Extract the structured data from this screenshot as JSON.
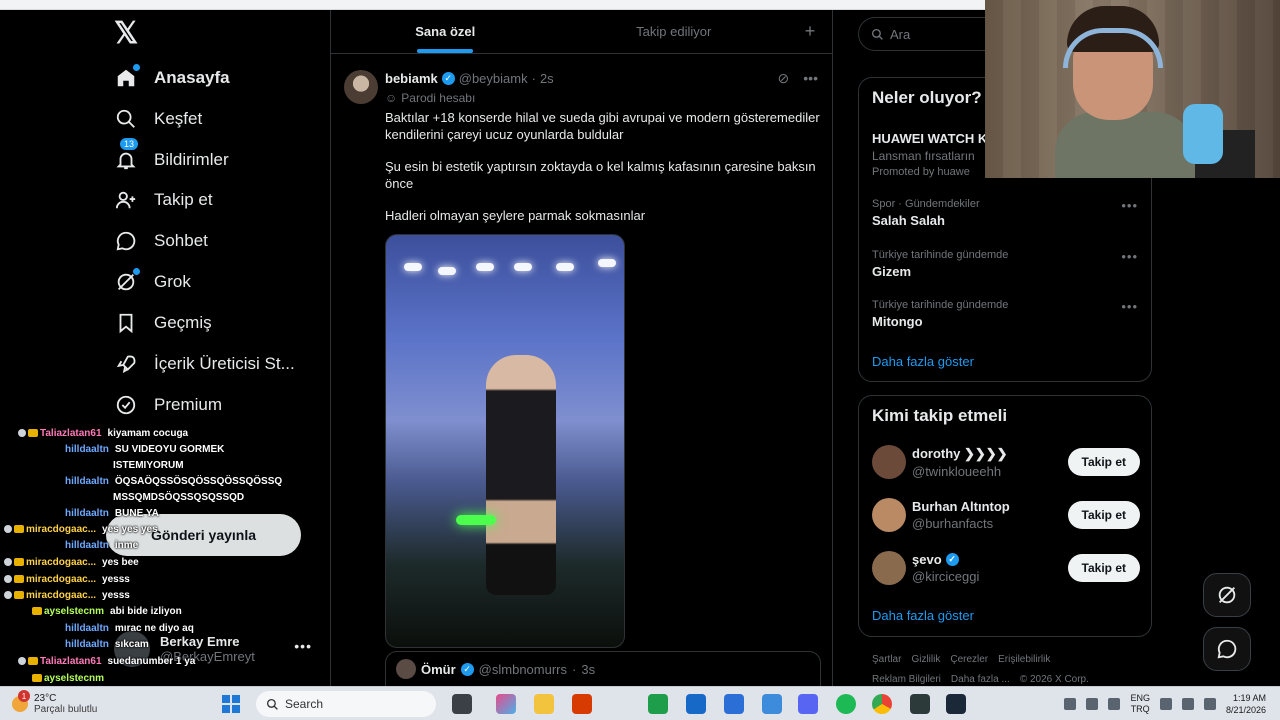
{
  "nav": {
    "items": [
      {
        "label": "Anasayfa",
        "icon": "home-icon"
      },
      {
        "label": "Keşfet",
        "icon": "search-icon"
      },
      {
        "label": "Bildirimler",
        "icon": "bell-icon",
        "badge": "13"
      },
      {
        "label": "Takip et",
        "icon": "add-user-icon"
      },
      {
        "label": "Sohbet",
        "icon": "chat-icon"
      },
      {
        "label": "Grok",
        "icon": "grok-icon"
      },
      {
        "label": "Geçmiş",
        "icon": "bookmark-icon"
      },
      {
        "label": "İçerik Üreticisi St...",
        "icon": "rocket-icon"
      },
      {
        "label": "Premium",
        "icon": "verified-icon"
      }
    ],
    "post_button": "Gönderi yayınla",
    "account": {
      "name": "Berkay Emre",
      "handle": "@BerkayEmreyt"
    }
  },
  "chat": [
    {
      "nick": "Taliazlatan61",
      "color": "#ff7ab8",
      "msg": "kiyamam cocuga"
    },
    {
      "nick": "hilldaaltn",
      "color": "#6ea8ff",
      "msg": "SU VIDEOYU GORMEK"
    },
    {
      "nick": "",
      "color": "#6ea8ff",
      "msg": "ISTEMIYORUM"
    },
    {
      "nick": "hilldaaltn",
      "color": "#6ea8ff",
      "msg": "ÖQSAÖQSSÖSQÖSSQÖSSQÖSSQ"
    },
    {
      "nick": "",
      "color": "#6ea8ff",
      "msg": "MSSQMDSÖQSSQSQSSQD"
    },
    {
      "nick": "hilldaaltn",
      "color": "#6ea8ff",
      "msg": "BUNE YA"
    },
    {
      "nick": "miracdogaac...",
      "color": "#ffd24a",
      "msg": "yes yes yes"
    },
    {
      "nick": "hilldaaltn",
      "color": "#6ea8ff",
      "msg": "inme"
    },
    {
      "nick": "miracdogaac...",
      "color": "#ffd24a",
      "msg": "yes bee"
    },
    {
      "nick": "miracdogaac...",
      "color": "#ffd24a",
      "msg": "yesss"
    },
    {
      "nick": "miracdogaac...",
      "color": "#ffd24a",
      "msg": "yesss"
    },
    {
      "nick": "ayselstecnm",
      "color": "#b4ff5a",
      "msg": "abi bide izliyon"
    },
    {
      "nick": "hilldaaltn",
      "color": "#6ea8ff",
      "msg": "mırac ne diyo aq"
    },
    {
      "nick": "hilldaaltn",
      "color": "#6ea8ff",
      "msg": "sıkcam"
    },
    {
      "nick": "Taliazlatan61",
      "color": "#ff7ab8",
      "msg": "suedanumber 1 ya"
    },
    {
      "nick": "ayselstecnm",
      "color": "#b4ff5a",
      "msg": ""
    }
  ],
  "center": {
    "tabs": [
      "Sana özel",
      "Takip ediliyor"
    ],
    "tweet": {
      "name": "bebiamk",
      "handle": "@beybiamk",
      "time": "2s",
      "parody": "Parodi hesabı",
      "paragraphs": [
        "Baktılar +18 konserde hilal ve sueda gibi avrupai ve modern gösteremediler kendilerini çareyi ucuz oyunlarda buldular",
        "Şu esin bi estetik yaptırsın zoktayda o kel kalmış kafasının çaresine baksın önce",
        "Hadleri olmayan şeylere parmak sokmasınlar"
      ]
    },
    "quote": {
      "name": "Ömür",
      "handle": "@slmbnomurrs",
      "time": "3s"
    }
  },
  "right": {
    "search_placeholder": "Ara",
    "trends_title": "Neler oluyor?",
    "trends": [
      {
        "context": "",
        "title": "HUAWEI WATCH KI",
        "sub": "Lansman fırsatların",
        "promo": "Promoted by huawe"
      },
      {
        "context": "Spor · Gündemdekiler",
        "title": "Salah Salah"
      },
      {
        "context": "Türkiye tarihinde gündemde",
        "title": "Gizem"
      },
      {
        "context": "Türkiye tarihinde gündemde",
        "title": "Mitongo"
      }
    ],
    "show_more": "Daha fazla göster",
    "who_title": "Kimi takip etmeli",
    "who": [
      {
        "name": "dorothy ❯❯❯❯",
        "handle": "@twinkloueehh",
        "verified": false
      },
      {
        "name": "Burhan Altıntop",
        "handle": "@burhanfacts",
        "verified": false
      },
      {
        "name": "şevo",
        "handle": "@kircicеggi",
        "verified": true
      }
    ],
    "follow_label": "Takip et",
    "footer_row1": [
      "Şartlar",
      "Gizlilik",
      "Çerezler",
      "Erişilebilirlik"
    ],
    "footer_row2": [
      "Reklam Bilgileri",
      "Daha fazla ...",
      "© 2026 X Corp."
    ]
  },
  "taskbar": {
    "weather_temp": "23°C",
    "weather_desc": "Parçalı bulutlu",
    "weather_badge": "1",
    "search": "Search",
    "lang1": "ENG",
    "lang2": "TRQ",
    "time": "1:19 AM",
    "date": "8/21/2026"
  }
}
